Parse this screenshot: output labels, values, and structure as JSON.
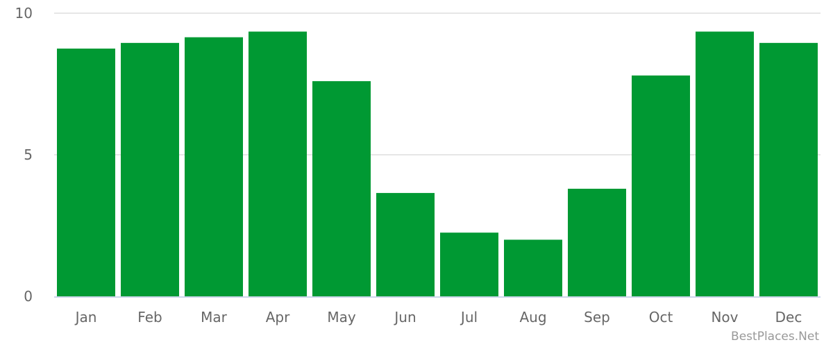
{
  "chart_data": {
    "type": "bar",
    "title": "",
    "xlabel": "",
    "ylabel": "",
    "categories": [
      "Jan",
      "Feb",
      "Mar",
      "Apr",
      "May",
      "Jun",
      "Jul",
      "Aug",
      "Sep",
      "Oct",
      "Nov",
      "Dec"
    ],
    "values": [
      8.75,
      8.95,
      9.15,
      9.35,
      7.6,
      3.65,
      2.25,
      2.0,
      3.8,
      7.8,
      9.35,
      8.95
    ],
    "ylim": [
      0,
      10
    ],
    "yticks": [
      "0",
      "5",
      "10"
    ],
    "ytick_values": [
      0,
      5,
      10
    ],
    "grid": true,
    "legend": "none",
    "bar_color": "#009933"
  },
  "credit": "BestPlaces.Net",
  "colors": {
    "bar": "#009933",
    "grid": "#e6e6e6",
    "axis": "#ccd6eb",
    "text": "#666666",
    "credit": "#999999"
  }
}
